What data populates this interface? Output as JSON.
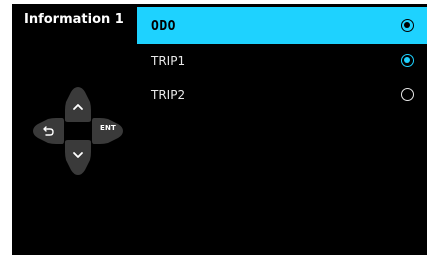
{
  "panel": {
    "title": "Information 1"
  },
  "menu": {
    "items": [
      {
        "label": "ODO",
        "selected": true,
        "checked": true
      },
      {
        "label": "TRIP1",
        "selected": false,
        "checked": true
      },
      {
        "label": "TRIP2",
        "selected": false,
        "checked": false
      }
    ]
  },
  "dpad": {
    "up_icon": "chevron-up-icon",
    "down_icon": "chevron-down-icon",
    "back_icon": "back-arrow-icon",
    "enter_label": "ENT"
  },
  "colors": {
    "background": "#000000",
    "highlight": "#1ed2ff",
    "text": "#e8e8e8",
    "button": "#3a3a3a"
  }
}
